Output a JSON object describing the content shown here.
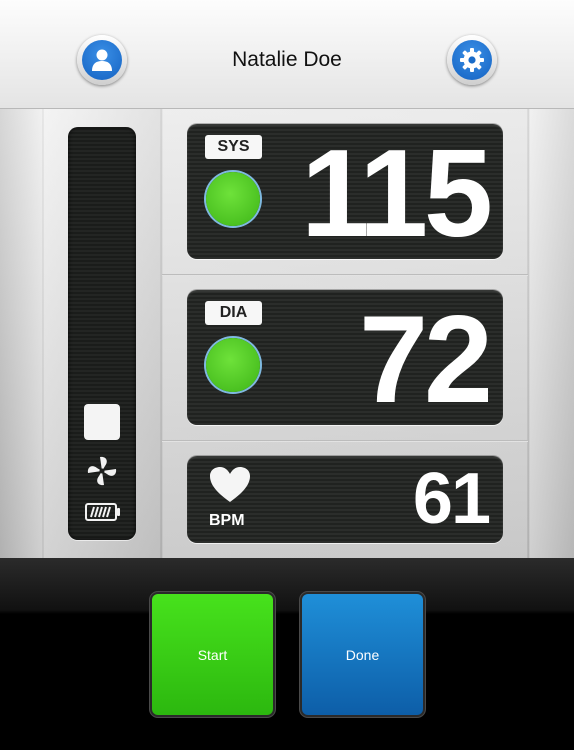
{
  "header": {
    "user_name": "Natalie Doe",
    "user_icon": "user-icon",
    "settings_icon": "gear-icon"
  },
  "gauge": {
    "stop_icon": "stop-icon",
    "fan_icon": "fan-icon",
    "battery_icon": "battery-icon"
  },
  "readings": {
    "sys": {
      "label": "SYS",
      "value": "115",
      "status_color": "#4fc926"
    },
    "dia": {
      "label": "DIA",
      "value": "72",
      "status_color": "#4fc926"
    },
    "pulse": {
      "label": "BPM",
      "value": "61",
      "icon": "heart-icon"
    }
  },
  "actions": {
    "start_label": "Start",
    "done_label": "Done",
    "start_color": "#38cc14",
    "done_color": "#1676c0"
  }
}
